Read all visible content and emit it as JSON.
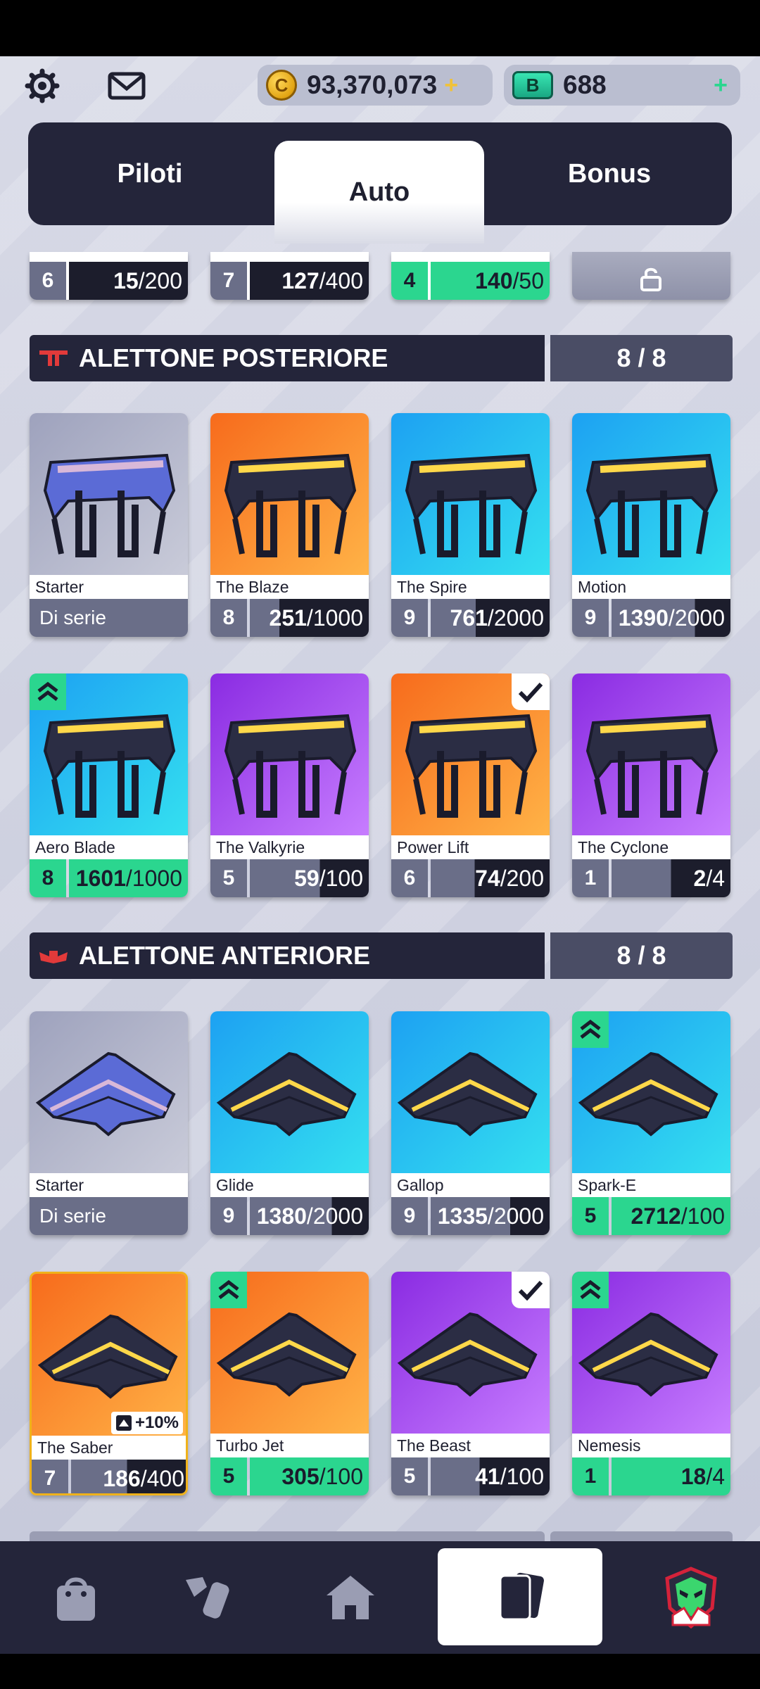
{
  "header": {
    "coins": "93,370,073",
    "coin_symbol": "C",
    "bucks_symbol": "B",
    "bucks": "688",
    "plus_symbol": "+"
  },
  "tabs": [
    {
      "label": "Piloti",
      "active": false
    },
    {
      "label": "Auto",
      "active": true
    },
    {
      "label": "Bonus",
      "active": false
    }
  ],
  "top_row": [
    {
      "level": "6",
      "current": "15",
      "target": "/200"
    },
    {
      "level": "7",
      "current": "127",
      "target": "/400"
    },
    {
      "level": "4",
      "current": "140",
      "target": "/50"
    },
    {
      "locked": true
    }
  ],
  "rear_wing": {
    "title": "ALETTONE POSTERIORE",
    "count": "8 / 8",
    "cards": [
      {
        "name": "Starter",
        "standard": "Di serie",
        "colors": [
          "#9ea2bd",
          "#c9cbd9"
        ]
      },
      {
        "name": "The Blaze",
        "level": "8",
        "current": "251",
        "target": "/1000",
        "progress": 0.251,
        "colors": [
          "#f76b1c",
          "#ffb347"
        ]
      },
      {
        "name": "The Spire",
        "level": "9",
        "current": "761",
        "target": "/2000",
        "progress": 0.38,
        "colors": [
          "#1da1f2",
          "#34e0f0"
        ]
      },
      {
        "name": "Motion",
        "level": "9",
        "current": "1390",
        "target": "/2000",
        "progress": 0.695,
        "colors": [
          "#1da1f2",
          "#34e0f0"
        ]
      },
      {
        "name": "Aero Blade",
        "level": "8",
        "current": "1601",
        "target": "/1000",
        "progress": 1.0,
        "ready": true,
        "rank": true,
        "colors": [
          "#1da1f2",
          "#34e0f0"
        ]
      },
      {
        "name": "The Valkyrie",
        "level": "5",
        "current": "59",
        "target": "/100",
        "progress": 0.59,
        "colors": [
          "#8a2be2",
          "#c77dff"
        ]
      },
      {
        "name": "Power Lift",
        "level": "6",
        "current": "74",
        "target": "/200",
        "progress": 0.37,
        "equipped": true,
        "colors": [
          "#f76b1c",
          "#ffb347"
        ]
      },
      {
        "name": "The Cyclone",
        "level": "1",
        "current": "2",
        "target": "/4",
        "progress": 0.5,
        "colors": [
          "#8a2be2",
          "#c77dff"
        ]
      }
    ]
  },
  "front_wing": {
    "title": "ALETTONE ANTERIORE",
    "count": "8 / 8",
    "cards": [
      {
        "name": "Starter",
        "standard": "Di serie",
        "colors": [
          "#9ea2bd",
          "#c9cbd9"
        ]
      },
      {
        "name": "Glide",
        "level": "9",
        "current": "1380",
        "target": "/2000",
        "progress": 0.69,
        "colors": [
          "#1da1f2",
          "#34e0f0"
        ]
      },
      {
        "name": "Gallop",
        "level": "9",
        "current": "1335",
        "target": "/2000",
        "progress": 0.667,
        "colors": [
          "#1da1f2",
          "#34e0f0"
        ]
      },
      {
        "name": "Spark-E",
        "level": "5",
        "current": "2712",
        "target": "/100",
        "progress": 1.0,
        "ready": true,
        "rank": true,
        "colors": [
          "#1da1f2",
          "#34e0f0"
        ]
      },
      {
        "name": "The Saber",
        "level": "7",
        "current": "186",
        "target": "/400",
        "progress": 0.465,
        "boost": "+10%",
        "colors": [
          "#f76b1c",
          "#ffb347"
        ]
      },
      {
        "name": "Turbo Jet",
        "level": "5",
        "current": "305",
        "target": "/100",
        "progress": 1.0,
        "ready": true,
        "rank": true,
        "colors": [
          "#f76b1c",
          "#ffb347"
        ]
      },
      {
        "name": "The Beast",
        "level": "5",
        "current": "41",
        "target": "/100",
        "progress": 0.41,
        "equipped": true,
        "colors": [
          "#8a2be2",
          "#c77dff"
        ]
      },
      {
        "name": "Nemesis",
        "level": "1",
        "current": "18",
        "target": "/4",
        "progress": 1.0,
        "ready": true,
        "rank": true,
        "colors": [
          "#8a2be2",
          "#c77dff"
        ]
      }
    ]
  },
  "nav": [
    {
      "icon": "shop-bag-icon"
    },
    {
      "icon": "paint-spray-icon"
    },
    {
      "icon": "home-icon"
    },
    {
      "icon": "cards-icon",
      "active": true
    },
    {
      "icon": "team-shield-icon"
    }
  ]
}
